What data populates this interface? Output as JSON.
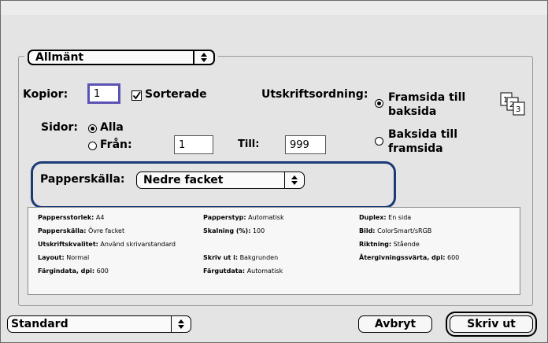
{
  "preset_popup": {
    "value": "Allmänt"
  },
  "copies": {
    "label": "Kopior:",
    "value": "1"
  },
  "collated": {
    "label": "Sorterade",
    "checked": true
  },
  "print_order": {
    "label": "Utskriftsordning:",
    "option_front_l1": "Framsida till",
    "option_front_l2": "baksida",
    "option_back_l1": "Baksida till",
    "option_back_l2": "framsida",
    "selected": "front"
  },
  "pages": {
    "label": "Sidor:",
    "all_label": "Alla",
    "from_label": "Från:",
    "from_value": "1",
    "to_label": "Till:",
    "to_value": "999",
    "selected": "all"
  },
  "paper_source": {
    "label": "Papperskälla:",
    "value": "Nedre facket"
  },
  "summary": {
    "col1": [
      {
        "k": "Pappersstorlek:",
        "v": "A4"
      },
      {
        "k": "Papperskälla:",
        "v": "Övre facket"
      },
      {
        "k": "Utskriftskvalitet:",
        "v": "Använd skrivarstandard"
      },
      {
        "k": "Layout:",
        "v": "Normal"
      },
      {
        "k": "Färgindata, dpi:",
        "v": "600"
      }
    ],
    "col2": [
      {
        "k": "Papperstyp:",
        "v": "Automatisk"
      },
      {
        "k": "Skalning (%):",
        "v": "100"
      },
      {
        "k": "",
        "v": ""
      },
      {
        "k": "Skriv ut i:",
        "v": "Bakgrunden"
      },
      {
        "k": "Färgutdata:",
        "v": "Automatisk"
      }
    ],
    "col3": [
      {
        "k": "Duplex:",
        "v": "En sida"
      },
      {
        "k": "Bild:",
        "v": "ColorSmart/sRGB"
      },
      {
        "k": "Riktning:",
        "v": "Stående"
      },
      {
        "k": "Återgivningssvärta, dpi:",
        "v": "600"
      },
      {
        "k": "",
        "v": ""
      }
    ]
  },
  "settings_popup": {
    "value": "Standard"
  },
  "buttons": {
    "cancel": "Avbryt",
    "print": "Skriv ut"
  },
  "colors": {
    "highlight": "#1b3a78",
    "focus_ring": "#5b52b6"
  }
}
